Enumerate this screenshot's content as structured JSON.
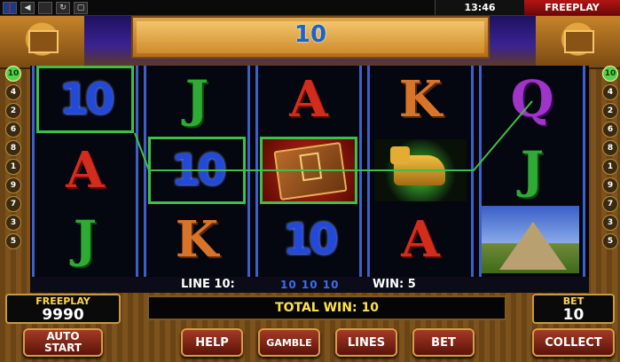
{
  "topbar": {
    "icons": [
      "flag-uk-icon",
      "speaker-icon",
      "blank-icon",
      "refresh-icon",
      "screen-icon"
    ],
    "clock": "13:46",
    "mode": "FREEPLAY"
  },
  "header": {
    "line_number": "10"
  },
  "paylines": {
    "left": [
      "10",
      "4",
      "2",
      "6",
      "8",
      "1",
      "9",
      "7",
      "3",
      "5"
    ],
    "right": [
      "10",
      "4",
      "2",
      "6",
      "8",
      "1",
      "9",
      "7",
      "3",
      "5"
    ],
    "active": "10"
  },
  "reels": [
    [
      "10",
      "A",
      "J"
    ],
    [
      "J",
      "10",
      "K"
    ],
    [
      "A",
      "book",
      "10"
    ],
    [
      "K",
      "monkey",
      "A"
    ],
    [
      "Q",
      "J",
      "pyramid"
    ]
  ],
  "winbar": {
    "line": "LINE 10:",
    "symbols": "10 10 10",
    "win": "WIN: 5"
  },
  "freeplay": {
    "label": "FREEPLAY",
    "value": "9990"
  },
  "total_win": "TOTAL WIN: 10",
  "bet": {
    "label": "BET",
    "value": "10"
  },
  "buttons": {
    "auto_line1": "AUTO",
    "auto_line2": "START",
    "help": "HELP",
    "gamble": "GAMBLE",
    "lines": "LINES",
    "bet": "BET",
    "collect": "COLLECT"
  },
  "colors": {
    "highlight": "#3fbf4a",
    "reel_border": "#3d5fc8",
    "button_bg": "#a33a26",
    "freeplay_bar": "#b31515"
  }
}
